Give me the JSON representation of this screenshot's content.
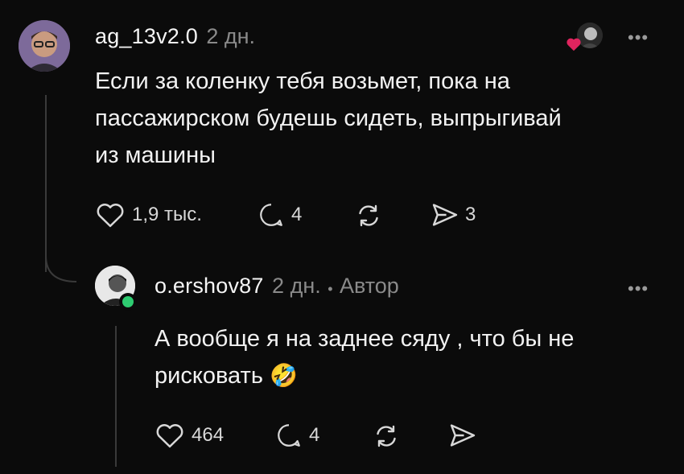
{
  "comment": {
    "username": "ag_13v2.0",
    "age": "2 дн.",
    "text_line1": "Если за коленку тебя возьмет, пока на",
    "text_line2": "пассажирском будешь сидеть, выпрыгивай",
    "text_line3": "из машины",
    "likes": "1,9 тыс.",
    "replies": "4",
    "shares": "3"
  },
  "reply": {
    "username": "o.ershov87",
    "age": "2 дн.",
    "separator": "•",
    "author_badge": "Автор",
    "text_line1": "А вообще я на заднее сяду , что бы не",
    "text_line2": "рисковать",
    "emoji": "🤣",
    "likes": "464",
    "replies": "4"
  },
  "colors": {
    "background": "#0b0b0b",
    "heart_badge": "#e0245e",
    "online_dot": "#2ecc71"
  },
  "icons": [
    "heart-icon",
    "comment-icon",
    "repost-icon",
    "send-icon",
    "more-icon"
  ]
}
